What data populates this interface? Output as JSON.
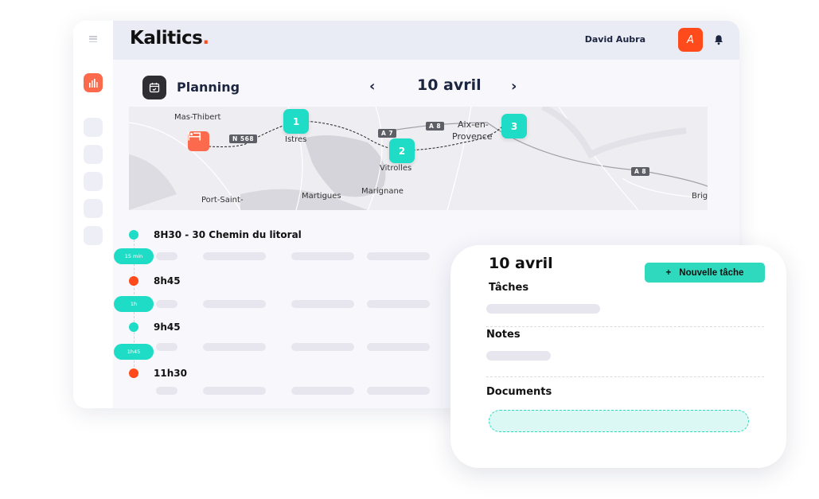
{
  "header": {
    "logo": "Kalitics",
    "logo_dot": ".",
    "user_name": "David Aubra",
    "avatar_initial": "A"
  },
  "sidebar": {
    "items": [
      {
        "icon": "bar-chart-icon",
        "active": true
      },
      {
        "icon": "placeholder",
        "active": false
      },
      {
        "icon": "placeholder",
        "active": false
      },
      {
        "icon": "placeholder",
        "active": false
      },
      {
        "icon": "placeholder",
        "active": false
      },
      {
        "icon": "placeholder",
        "active": false
      }
    ]
  },
  "planning": {
    "title": "Planning",
    "prev": "‹",
    "date": "10 avril",
    "next": "›"
  },
  "map": {
    "cities": [
      "Mas-Thibert",
      "Istres",
      "Vitrolles",
      "Marignane",
      "Martigues",
      "Port-Saint-",
      "Aix-en-",
      "Provence",
      "Brig"
    ],
    "roads": [
      "N 568",
      "A 7",
      "A 8",
      "A 8"
    ],
    "stops": [
      "1",
      "2",
      "3"
    ],
    "start_icon": "hotel-bed-icon"
  },
  "timeline": {
    "entries": [
      {
        "time": "8H30 - 30 Chemin du litoral",
        "color": "teal"
      },
      {
        "time": "8h45",
        "color": "red"
      },
      {
        "time": "9h45",
        "color": "teal"
      },
      {
        "time": "11h30",
        "color": "red"
      }
    ],
    "durations": [
      "15 min",
      "1h",
      "1h45"
    ]
  },
  "panel": {
    "date": "10 avril",
    "new_task_plus": "+",
    "new_task_label": "Nouvelle tâche",
    "tasks_label": "Tâches",
    "notes_label": "Notes",
    "documents_label": "Documents"
  },
  "colors": {
    "accent_teal": "#1edcc6",
    "accent_orange": "#ff4a1c",
    "nav_active": "#fb6a4c"
  }
}
